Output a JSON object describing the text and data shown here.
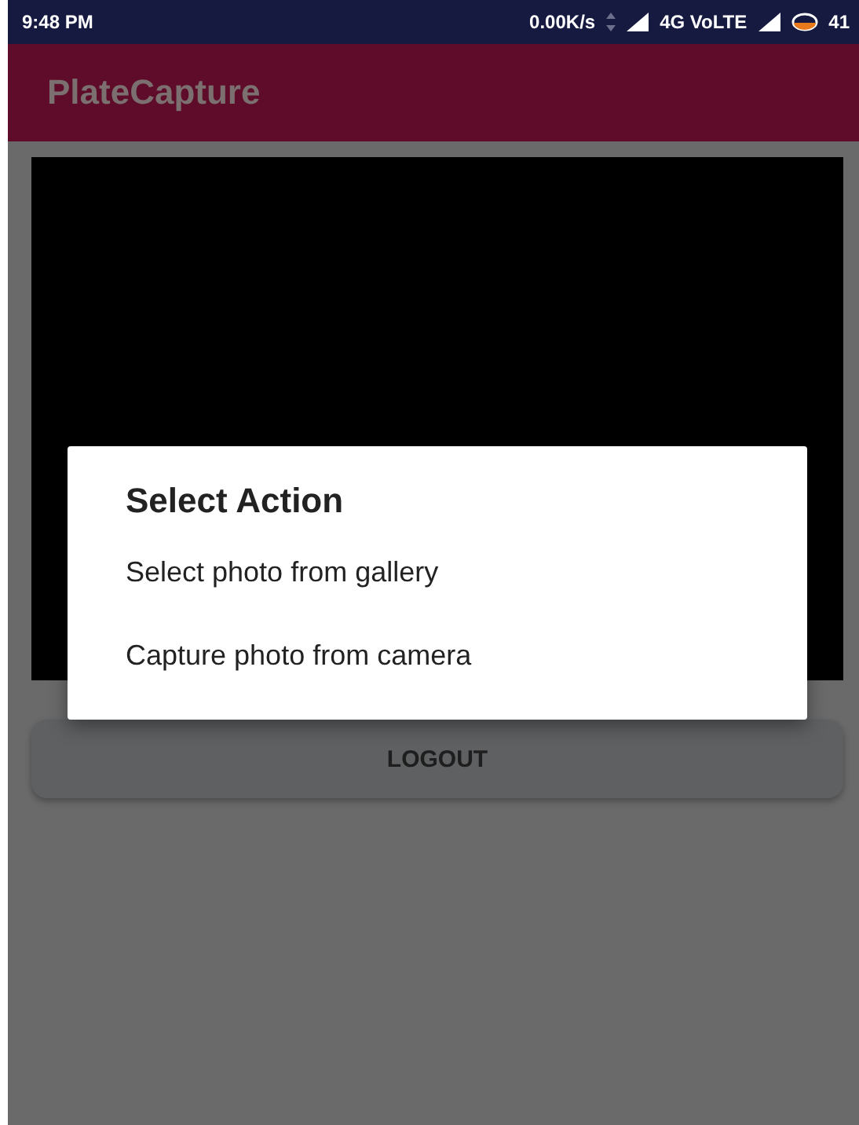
{
  "status_bar": {
    "time": "9:48 PM",
    "speed": "0.00K/s",
    "network": "4G VoLTE",
    "battery": "41"
  },
  "app_bar": {
    "title": "PlateCapture"
  },
  "buttons": [
    {
      "label": "LOGOUT"
    }
  ],
  "dialog": {
    "title": "Select Action",
    "options": [
      "Select photo from gallery",
      "Capture photo from camera"
    ]
  }
}
